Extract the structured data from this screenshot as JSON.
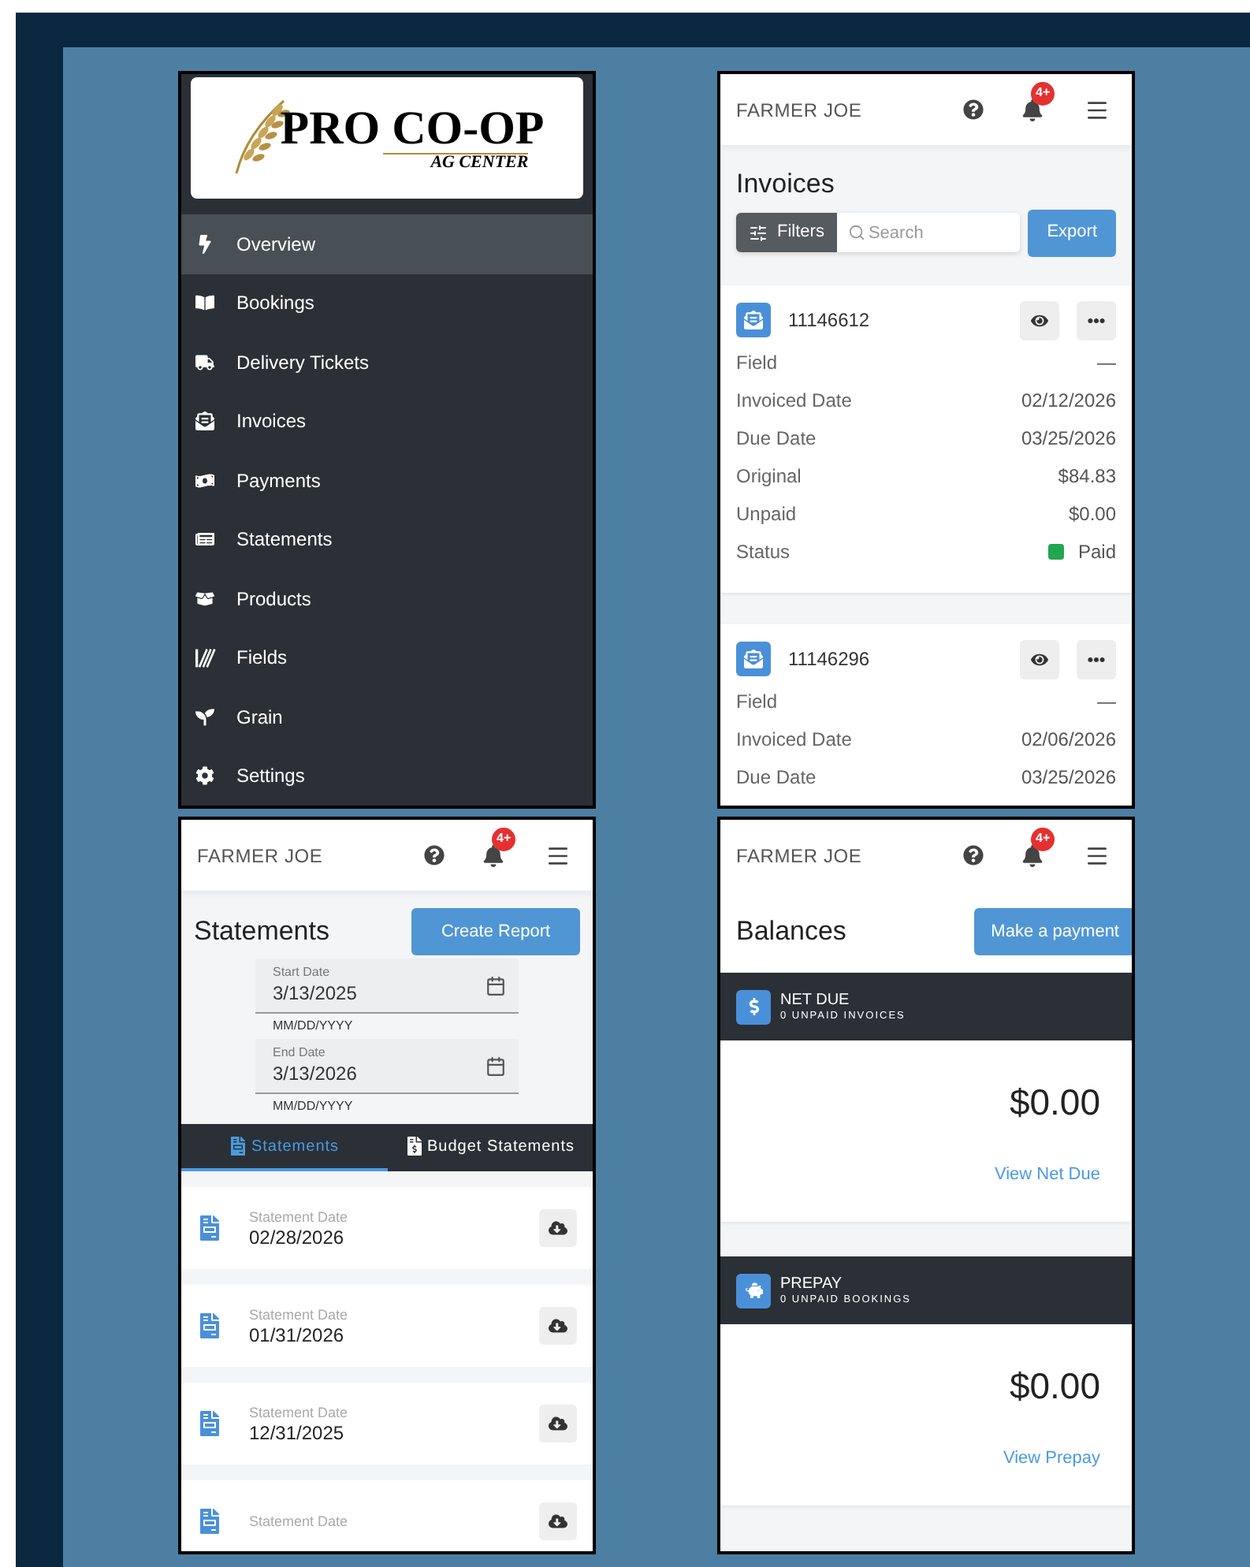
{
  "sidebar_screen": {
    "logo": {
      "name": "PRO CO-OP",
      "tagline": "AG CENTER"
    },
    "items": [
      {
        "label": "Overview",
        "selected": true
      },
      {
        "label": "Bookings",
        "selected": false
      },
      {
        "label": "Delivery Tickets",
        "selected": false
      },
      {
        "label": "Invoices",
        "selected": false
      },
      {
        "label": "Payments",
        "selected": false
      },
      {
        "label": "Statements",
        "selected": false
      },
      {
        "label": "Products",
        "selected": false
      },
      {
        "label": "Fields",
        "selected": false
      },
      {
        "label": "Grain",
        "selected": false
      },
      {
        "label": "Settings",
        "selected": false
      }
    ]
  },
  "invoices_screen": {
    "header": {
      "user": "FARMER JOE",
      "badge": "4+"
    },
    "title": "Invoices",
    "filters_button": "Filters",
    "search": {
      "placeholder": "Search"
    },
    "export_button": "Export",
    "invoices": [
      {
        "number": "11146612",
        "rows": [
          {
            "label": "Field",
            "value": "—"
          },
          {
            "label": "Invoiced Date",
            "value": "02/12/2026"
          },
          {
            "label": "Due Date",
            "value": "03/25/2026"
          },
          {
            "label": "Original",
            "value": "$84.83"
          },
          {
            "label": "Unpaid",
            "value": "$0.00"
          },
          {
            "label": "Status",
            "value": "Paid",
            "color": "#22a652"
          }
        ]
      },
      {
        "number": "11146296",
        "rows": [
          {
            "label": "Field",
            "value": "—"
          },
          {
            "label": "Invoiced Date",
            "value": "02/06/2026"
          },
          {
            "label": "Due Date",
            "value": "03/25/2026"
          }
        ]
      }
    ]
  },
  "statements_screen": {
    "header": {
      "user": "FARMER JOE",
      "badge": "4+"
    },
    "title": "Statements",
    "create_button": "Create Report",
    "date_fields": [
      {
        "label": "Start Date",
        "value": "3/13/2025",
        "helper": "MM/DD/YYYY"
      },
      {
        "label": "End Date",
        "value": "3/13/2026",
        "helper": "MM/DD/YYYY"
      }
    ],
    "tabs": [
      {
        "label": "Statements",
        "selected": true
      },
      {
        "label": "Budget Statements",
        "selected": false
      }
    ],
    "statements": [
      {
        "label": "Statement Date",
        "date": "02/28/2026"
      },
      {
        "label": "Statement Date",
        "date": "01/31/2026"
      },
      {
        "label": "Statement Date",
        "date": "12/31/2025"
      },
      {
        "label": "Statement Date"
      }
    ]
  },
  "balances_screen": {
    "header": {
      "user": "FARMER JOE",
      "badge": "4+"
    },
    "title": "Balances",
    "payment_button": "Make a payment",
    "sections": [
      {
        "title": "NET DUE",
        "subtitle": "0 UNPAID INVOICES",
        "amount": "$0.00",
        "link": "View Net Due"
      },
      {
        "title": "PREPAY",
        "subtitle": "0 UNPAID BOOKINGS",
        "amount": "$0.00",
        "link": "View Prepay"
      }
    ]
  }
}
